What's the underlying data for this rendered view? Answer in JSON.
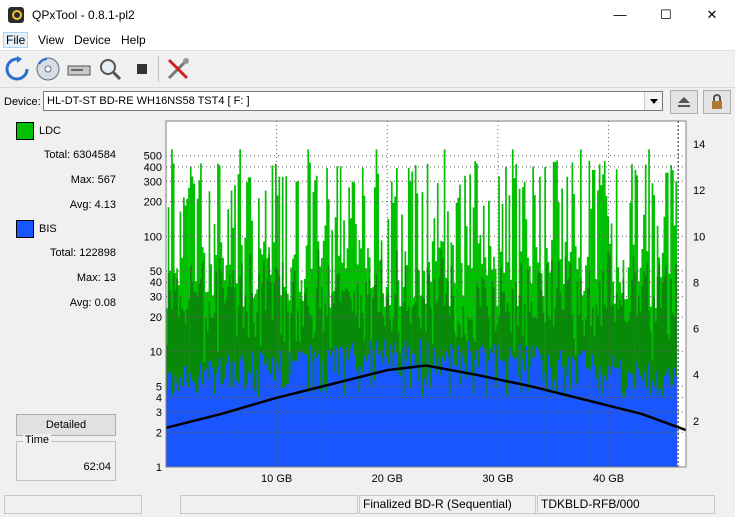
{
  "window": {
    "title": "QPxTool - 0.8.1-pl2",
    "minimize": "—",
    "maximize": "☐",
    "close": "✕"
  },
  "menu": [
    "File",
    "View",
    "Device",
    "Help"
  ],
  "toolbar_icons": [
    "refresh-icon",
    "disc-icon",
    "drive-icon",
    "magnifier-icon",
    "stop-icon",
    "tools-icon"
  ],
  "device": {
    "label": "Device:",
    "value": "HL-DT-ST BD-RE  WH16NS58  TST4 [ F: ]"
  },
  "legend": {
    "ldc": {
      "name": "LDC",
      "color": "#00c000",
      "total": "Total: 6304584",
      "max": "Max: 567",
      "avg": "Avg: 4.13"
    },
    "bis": {
      "name": "BIS",
      "color": "#1a56ff",
      "total": "Total: 122898",
      "max": "Max: 13",
      "avg": "Avg: 0.08"
    }
  },
  "detailed_button": "Detailed",
  "time": {
    "label": "Time",
    "value": "62:04"
  },
  "status": {
    "left": "",
    "middle": "",
    "disc": "Finalized BD-R (Sequential)",
    "media_id": "TDKBLD-RFB/000"
  },
  "chart_data": {
    "type": "area",
    "x_range_gb": [
      0,
      47
    ],
    "x_ticks": [
      "10 GB",
      "20 GB",
      "30 GB",
      "40 GB"
    ],
    "x_tick_values": [
      10,
      20,
      30,
      40
    ],
    "y_left_scale": "log",
    "y_left_range": [
      1,
      1000
    ],
    "y_left_ticks": [
      "500",
      "400",
      "300",
      "200",
      "100",
      "50",
      "40",
      "30",
      "20",
      "10",
      "5",
      "4",
      "3",
      "2",
      "1"
    ],
    "y_left_tick_values": [
      500,
      400,
      300,
      200,
      100,
      50,
      40,
      30,
      20,
      10,
      5,
      4,
      3,
      2,
      1
    ],
    "y_right_range": [
      0,
      15
    ],
    "y_right_ticks": [
      "14",
      "12",
      "10",
      "8",
      "6",
      "4",
      "2"
    ],
    "y_right_tick_values": [
      14,
      12,
      10,
      8,
      6,
      4,
      2
    ],
    "grid": true,
    "series": [
      {
        "name": "LDC",
        "color": "#00c000",
        "axis": "left",
        "peak_range": [
          40,
          567
        ]
      },
      {
        "name": "BIS",
        "color": "#1a56ff",
        "axis": "left",
        "peak_range": [
          4,
          13
        ]
      },
      {
        "color": "#000000",
        "axis": "right",
        "x": [
          0,
          5,
          10,
          15,
          20,
          23.5,
          28,
          33,
          38,
          43,
          47
        ],
        "y": [
          1.7,
          2.3,
          3.0,
          3.6,
          4.2,
          4.4,
          4.0,
          3.5,
          2.9,
          2.3,
          1.6
        ]
      }
    ]
  }
}
